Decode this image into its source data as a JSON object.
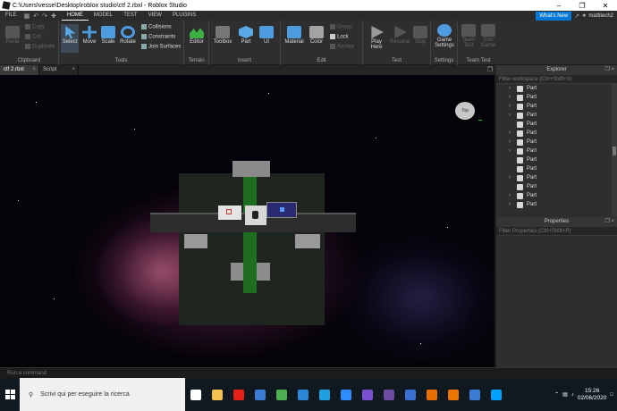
{
  "window": {
    "title": "C:\\Users\\vesse\\Desktop\\roblox studio\\ctf 2.rbxl - Roblox Studio"
  },
  "menubar": {
    "file": "FILE",
    "tabs": [
      "HOME",
      "MODEL",
      "TEST",
      "VIEW",
      "PLUGINS"
    ],
    "whats_new": "What's New",
    "user": "mattitech2"
  },
  "ribbon": {
    "clipboard": {
      "paste": "Paste",
      "copy": "Copy",
      "cut": "Cut",
      "duplicate": "Duplicate",
      "label": "Clipboard"
    },
    "tools": {
      "select": "Select",
      "move": "Move",
      "scale": "Scale",
      "rotate": "Rotate",
      "collisions": "Collisions",
      "constraints": "Constraints",
      "join_surfaces": "Join Surfaces",
      "label": "Tools"
    },
    "terrain": {
      "editor": "Editor",
      "label": "Terrain"
    },
    "insert": {
      "toolbox": "Toolbox",
      "part": "Part",
      "ui": "UI",
      "label": "Insert"
    },
    "edit": {
      "material": "Material",
      "color": "Color",
      "group": "Group",
      "lock": "Lock",
      "anchor": "Anchor",
      "label": "Edit"
    },
    "test": {
      "play_here": "Play Here",
      "resume": "Resume",
      "stop": "Stop",
      "label": "Test"
    },
    "settings": {
      "game_settings": "Game Settings",
      "label": "Settings"
    },
    "team_test": {
      "team_test": "Team Test",
      "exit_game": "Exit Game",
      "label": "Team Test"
    }
  },
  "doctabs": [
    "ctf 2.rbxl",
    "Script"
  ],
  "viewcube": {
    "label": "Top"
  },
  "explorer": {
    "title": "Explorer",
    "filter": "Filter workspace (Ctrl+Shift+X)",
    "items": [
      {
        "label": "Part",
        "expandable": true
      },
      {
        "label": "Part",
        "expandable": true
      },
      {
        "label": "Part",
        "expandable": true
      },
      {
        "label": "Part",
        "expandable": true
      },
      {
        "label": "Part",
        "expandable": false
      },
      {
        "label": "Part",
        "expandable": true
      },
      {
        "label": "Part",
        "expandable": true
      },
      {
        "label": "Part",
        "expandable": true
      },
      {
        "label": "Part",
        "expandable": false
      },
      {
        "label": "Part",
        "expandable": false
      },
      {
        "label": "Part",
        "expandable": true
      },
      {
        "label": "Part",
        "expandable": false
      },
      {
        "label": "Part",
        "expandable": true
      },
      {
        "label": "Part",
        "expandable": true
      }
    ]
  },
  "properties": {
    "title": "Properties",
    "filter": "Filter Properties (Ctrl+Shift+P)"
  },
  "command_bar": {
    "placeholder": "Run a command"
  },
  "taskbar": {
    "search_placeholder": "Scrivi qui per eseguire la ricerca",
    "time": "15:26",
    "date": "02/06/2020",
    "apps": [
      {
        "name": "task-view-icon",
        "color": "#ffffff"
      },
      {
        "name": "file-explorer-icon",
        "color": "#f2c14e"
      },
      {
        "name": "youtube-icon",
        "color": "#e62117"
      },
      {
        "name": "store-icon",
        "color": "#3a7bd5"
      },
      {
        "name": "chrome-icon",
        "color": "#4caf50"
      },
      {
        "name": "mail-icon",
        "color": "#2b88d8"
      },
      {
        "name": "edge-icon",
        "color": "#1fa0e0"
      },
      {
        "name": "zoom-icon",
        "color": "#2d8cff"
      },
      {
        "name": "app-icon",
        "color": "#7a4fd0"
      },
      {
        "name": "app-jw-icon",
        "color": "#6b4ca0"
      },
      {
        "name": "app-icon-2",
        "color": "#3b6fd1"
      },
      {
        "name": "java-icon",
        "color": "#e76f00"
      },
      {
        "name": "blender-icon",
        "color": "#ea7600"
      },
      {
        "name": "roblox-icon",
        "color": "#3a7bd5"
      },
      {
        "name": "roblox-studio-icon",
        "color": "#00a2ff"
      }
    ]
  }
}
